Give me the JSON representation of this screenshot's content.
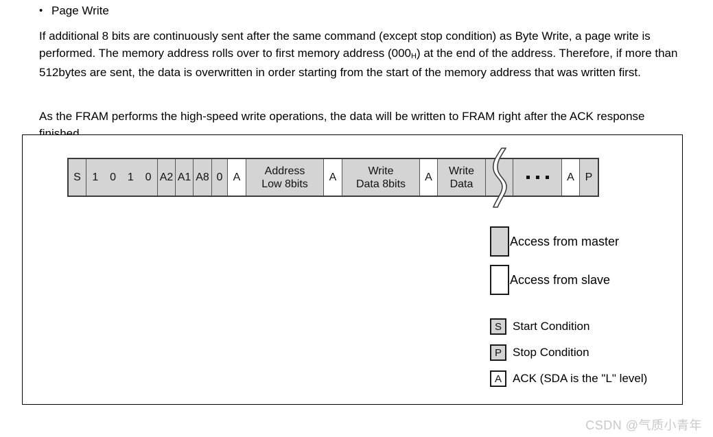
{
  "heading": {
    "bullet": "•",
    "text": "Page Write"
  },
  "paragraphs": {
    "p1_part1": "If additional 8 bits are continuously sent after the same command (except stop condition) as Byte Write, a page write is performed. The memory address rolls over to first memory address (000",
    "p1_sub": "H",
    "p1_part2": ") at the end of the address. Therefore, if more than 512bytes are sent, the data is overwritten in order starting from the start of the memory address that was written first.",
    "p2": "As the FRAM performs the high-speed write operations, the data will be written to FRAM right after the ACK response finished."
  },
  "frame": {
    "cells": [
      {
        "id": "start",
        "label": "S",
        "fill": "master"
      },
      {
        "id": "device-bits",
        "label": "1 0 1 0",
        "fill": "master"
      },
      {
        "id": "addr-a2",
        "label": "A2",
        "fill": "master"
      },
      {
        "id": "addr-a1",
        "label": "A1",
        "fill": "master"
      },
      {
        "id": "addr-a8",
        "label": "A8",
        "fill": "master"
      },
      {
        "id": "rw-bit",
        "label": "0",
        "fill": "master"
      },
      {
        "id": "ack-1",
        "label": "A",
        "fill": "slave"
      },
      {
        "id": "address-low",
        "label": "Address Low 8bits",
        "line1": "Address",
        "line2": "Low 8bits",
        "fill": "master"
      },
      {
        "id": "ack-2",
        "label": "A",
        "fill": "slave"
      },
      {
        "id": "write-data-8",
        "label": "Write Data 8bits",
        "line1": "Write",
        "line2": "Data 8bits",
        "fill": "master"
      },
      {
        "id": "ack-3",
        "label": "A",
        "fill": "slave"
      },
      {
        "id": "write-data",
        "label": "Write Data",
        "line1": "Write",
        "line2": "Data",
        "fill": "master"
      },
      {
        "id": "break-gap",
        "label": "",
        "fill": "master"
      },
      {
        "id": "ellipsis",
        "label": "...",
        "fill": "master"
      },
      {
        "id": "ack-4",
        "label": "A",
        "fill": "slave"
      },
      {
        "id": "stop",
        "label": "P",
        "fill": "master"
      }
    ],
    "bits": [
      "1",
      "0",
      "1",
      "0"
    ],
    "break_icon": "waveform-break-icon"
  },
  "legend": {
    "access": [
      {
        "swatch": "master",
        "label": "Access from master"
      },
      {
        "swatch": "slave",
        "label": "Access from slave"
      }
    ],
    "symbols": [
      {
        "glyph": "S",
        "fill": "gray",
        "label": "Start Condition"
      },
      {
        "glyph": "P",
        "fill": "gray",
        "label": "Stop Condition"
      },
      {
        "glyph": "A",
        "fill": "white",
        "label": "ACK (SDA is the \"L\" level)"
      }
    ]
  },
  "watermark": {
    "text": "CSDN @气质小青年"
  },
  "colors": {
    "master_fill": "#d4d4d4",
    "slave_fill": "#ffffff",
    "outline": "#1a1a1a",
    "watermark": "#c9c9c9"
  }
}
